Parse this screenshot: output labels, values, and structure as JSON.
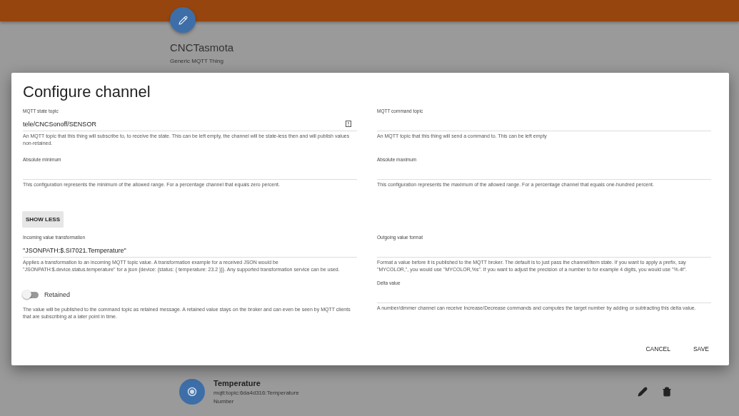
{
  "thing": {
    "title": "CNCTasmota",
    "subtitle": "Generic MQTT Thing"
  },
  "dialog": {
    "title": "Configure channel",
    "fields": [
      {
        "kind": "text",
        "label": "MQTT state topic",
        "value": "tele/CNCSonoff/SENSOR",
        "help": "An MQTT topic that this thing will subscribe to, to receive the state. This can be left empty, the channel will be state-less then and will publish values non-retained.",
        "has_picker": true
      },
      {
        "kind": "text",
        "label": "MQTT command topic",
        "help": "An MQTT topic that this thing will send a command to. This can be left empty"
      },
      {
        "kind": "text",
        "label": "Absolute minimum",
        "help": "This configuration represents the minimum of the allowed range. For a percentage channel that equals zero percent."
      },
      {
        "kind": "text",
        "label": "Absolute maximum",
        "help": "This configuration represents the maximum of the allowed range. For a percentage channel that equals one-hundred percent."
      }
    ],
    "toggle_button": "SHOW LESS",
    "advanced_fields": [
      {
        "kind": "text",
        "label": "Incoming value transformation",
        "value": "\"JSONPATH:$.SI7021.Temperature\"",
        "help": "Applies a transformation to an incoming MQTT topic value. A transformation example for a received JSON would be \"JSONPATH:$.device.status.temperature\" for a json {device: {status: { temperature: 23.2 }}}. Any supported transformation service can be used."
      },
      {
        "kind": "switch",
        "label": "Retained",
        "on": false,
        "help": "The value will be published to the command topic as retained message. A retained value stays on the broker and can even be seen by MQTT clients that are subscribing at a later point in time."
      },
      {
        "kind": "text",
        "label": "Outgoing value format",
        "help": "Format a value before it is published to the MQTT broker. The default is to just pass the channel/item state. If you want to apply a prefix, say \"MYCOLOR,\", you would use \"MYCOLOR,%s\". If you want to adjust the precision of a number to for example 4 digits, you would use \"%.4f\"."
      },
      {
        "kind": "text",
        "label": "Delta value",
        "help": "A number/dimmer channel can receive Increase/Decrease commands and computes the target number by adding or subtracting this delta value."
      }
    ],
    "buttons": [
      "CANCEL",
      "SAVE"
    ]
  },
  "channel": {
    "name": "Temperature",
    "uid": "mqtt:topic:6da4d316:Temperature",
    "type": "Number"
  }
}
